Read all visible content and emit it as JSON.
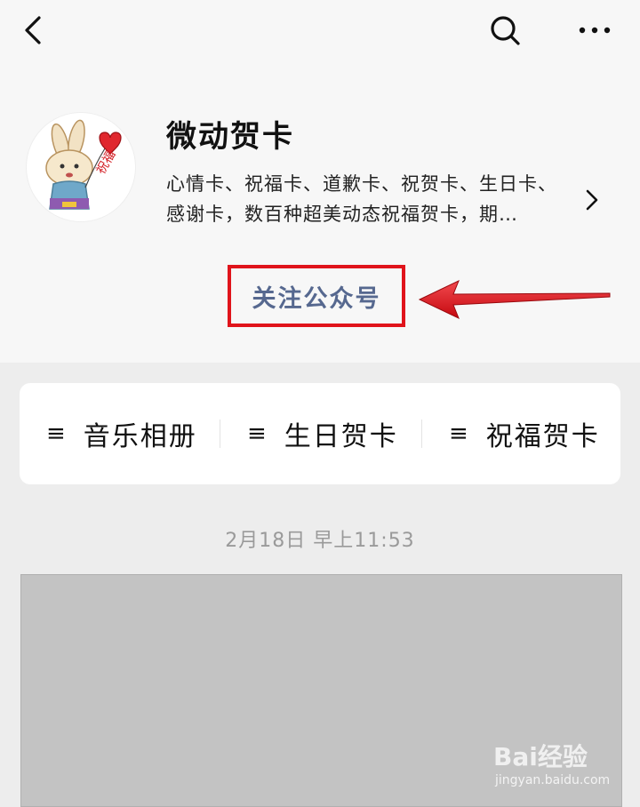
{
  "header": {
    "back_icon": "chevron-left-icon",
    "search_icon": "search-icon",
    "more_icon": "more-dots-icon"
  },
  "profile": {
    "name": "微动贺卡",
    "description_line1": "心情卡、祝福卡、道歉卡、祝贺卡、生日卡、",
    "description_line2": "感谢卡，数百种超美动态祝福贺卡，期…",
    "avatar_text": "祝福",
    "avatar_icon": "rabbit-balloon-avatar"
  },
  "follow": {
    "label": "关注公众号",
    "highlight_color": "#e0141b"
  },
  "menu": {
    "items": [
      {
        "icon": "≡",
        "label": "音乐相册"
      },
      {
        "icon": "≡",
        "label": "生日贺卡"
      },
      {
        "icon": "≡",
        "label": "祝福贺卡"
      }
    ]
  },
  "feed": {
    "timestamp": "2月18日 早上11:53"
  },
  "watermark": {
    "brand": "Bai经验",
    "url": "jingyan.baidu.com"
  }
}
